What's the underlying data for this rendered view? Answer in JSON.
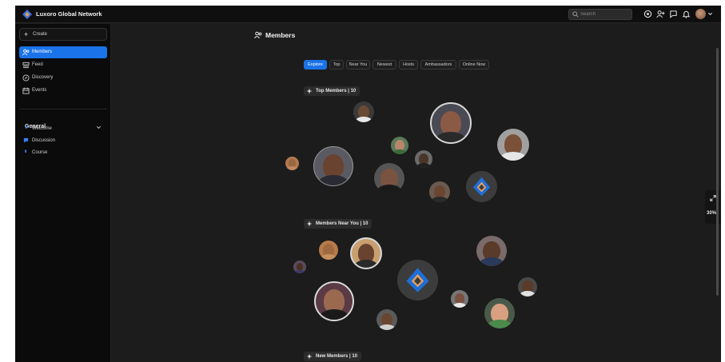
{
  "app": {
    "title": "Luxoro Global Network",
    "brand_color": "#1a73e8"
  },
  "topbar": {
    "search_placeholder": "Search",
    "icons": [
      "search-icon",
      "globe-icon",
      "users-icon",
      "chat-icon",
      "bell-icon",
      "avatar",
      "chevron-down-icon"
    ]
  },
  "sidebar": {
    "create_label": "Create",
    "nav": [
      {
        "label": "Members",
        "icon": "members-icon",
        "active": true
      },
      {
        "label": "Feed",
        "icon": "feed-icon",
        "active": false
      },
      {
        "label": "Discovery",
        "icon": "compass-icon",
        "active": false
      },
      {
        "label": "Events",
        "icon": "calendar-icon",
        "active": false
      }
    ],
    "section_title": "General",
    "channels": [
      {
        "label": "Welcome",
        "icon": "rocket-icon"
      },
      {
        "label": "Discussion",
        "icon": "chat-bubble-icon"
      },
      {
        "label": "Course",
        "icon": "book-icon"
      }
    ]
  },
  "main": {
    "page_title": "Members",
    "tabs": [
      "Explore",
      "Top",
      "Near You",
      "Newest",
      "Hosts",
      "Ambassadors",
      "Online Now"
    ],
    "active_tab": "Explore",
    "sections": [
      {
        "label": "Top Members | 10"
      },
      {
        "label": "Members Near You | 10"
      },
      {
        "label": "New Members | 10"
      }
    ],
    "zoom": "30%"
  }
}
